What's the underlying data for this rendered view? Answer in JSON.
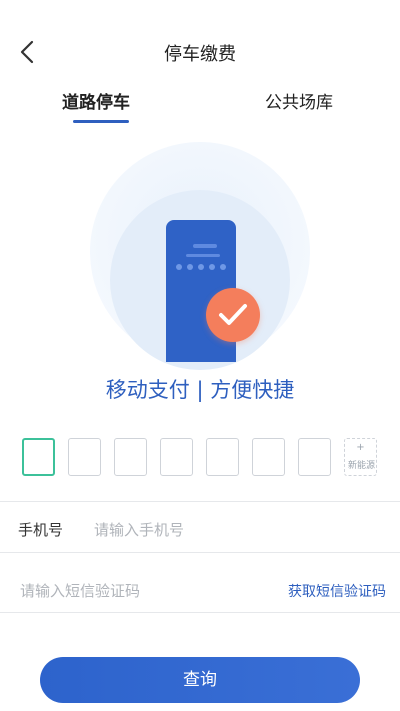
{
  "header": {
    "title": "停车缴费",
    "back_icon": "chevron-left-icon"
  },
  "tabs": [
    {
      "label": "道路停车",
      "active": true
    },
    {
      "label": "公共场库",
      "active": false
    }
  ],
  "illustration": {
    "slogan": "移动支付 | 方便快捷",
    "check_icon": "checkmark-icon"
  },
  "plate": {
    "boxes": [
      "",
      "",
      "",
      "",
      "",
      "",
      ""
    ],
    "new_energy_plus": "+",
    "new_energy_label": "新能源"
  },
  "form": {
    "phone_label": "手机号",
    "phone_placeholder": "请输入手机号",
    "code_placeholder": "请输入短信验证码",
    "get_code_label": "获取短信验证码"
  },
  "query_button": "查询",
  "colors": {
    "accent": "#2e5fbf",
    "check": "#f47e5c",
    "active_plate": "#3cc19a"
  }
}
